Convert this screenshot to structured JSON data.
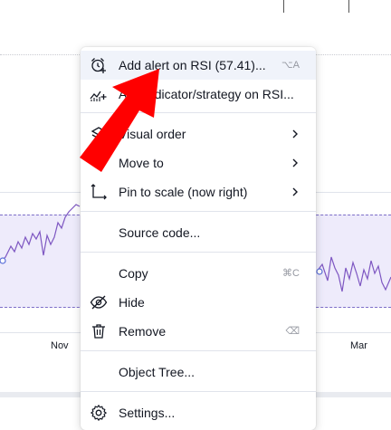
{
  "chart": {
    "time_labels": [
      "Nov",
      "Mar"
    ],
    "colors": {
      "rsi_line": "#7e57c2",
      "band_fill": "#eeebfb",
      "band_border": "#7d6ec8"
    }
  },
  "context_menu": {
    "items": [
      {
        "label": "Add alert on RSI (57.41)...",
        "shortcut": "⌥A",
        "icon": "alarm-clock-plus-icon"
      },
      {
        "label": "Add indicator/strategy on RSI...",
        "icon": "indicator-plus-icon"
      },
      {
        "label": "Visual order",
        "icon": "layers-icon",
        "submenu": true
      },
      {
        "label": "Move to",
        "submenu": true
      },
      {
        "label": "Pin to scale (now right)",
        "icon": "pin-scale-icon",
        "submenu": true
      },
      {
        "label": "Source code..."
      },
      {
        "label": "Copy",
        "shortcut": "⌘C"
      },
      {
        "label": "Hide",
        "icon": "eye-off-icon"
      },
      {
        "label": "Remove",
        "shortcut": "⌫",
        "icon": "trash-icon"
      },
      {
        "label": "Object Tree..."
      },
      {
        "label": "Settings...",
        "icon": "gear-icon"
      }
    ]
  },
  "annotation": {
    "arrow_color": "#ff0000"
  }
}
